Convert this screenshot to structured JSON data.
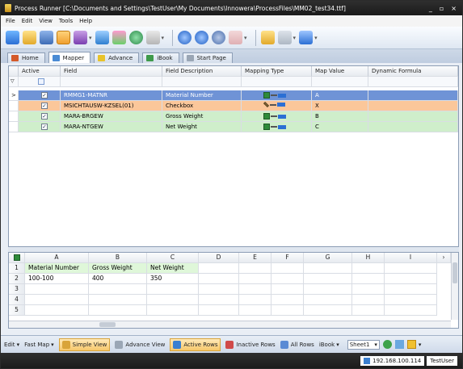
{
  "window": {
    "title": "Process Runner [C:\\Documents and Settings\\TestUser\\My Documents\\Innowera\\ProcessFiles\\MM02_test34.ttf]",
    "minimize": "_",
    "maximize": "▫",
    "close": "×"
  },
  "menu": [
    "File",
    "Edit",
    "View",
    "Tools",
    "Help"
  ],
  "tabs": [
    {
      "label": "Home",
      "icon": "home-icon"
    },
    {
      "label": "Mapper",
      "icon": "mapper-icon"
    },
    {
      "label": "Advance",
      "icon": "advance-icon"
    },
    {
      "label": "iBook",
      "icon": "ibook-icon"
    },
    {
      "label": "Start Page",
      "icon": "start-page-icon"
    }
  ],
  "mapping_grid": {
    "columns": [
      "Active",
      "Field",
      "Field Description",
      "Mapping Type",
      "Map Value",
      "Dynamic Formula"
    ],
    "row_indicator": ">",
    "rows": [
      {
        "active": "✓",
        "field": "RMMG1-MATNR",
        "description": "Material Number",
        "map_value": "A",
        "mapping_type": "excel-column",
        "color": "#6f93d6"
      },
      {
        "active": "✓",
        "field": "MSICHTAUSW-KZSEL(01)",
        "description": "Checkbox",
        "map_value": "X",
        "mapping_type": "fixed-value",
        "color": "#fbc79a"
      },
      {
        "active": "✓",
        "field": "MARA-BRGEW",
        "description": "Gross Weight",
        "map_value": "B",
        "mapping_type": "excel-column",
        "color": "#cfeecb"
      },
      {
        "active": "✓",
        "field": "MARA-NTGEW",
        "description": "Net Weight",
        "map_value": "C",
        "mapping_type": "excel-column",
        "color": "#cfeecb"
      }
    ]
  },
  "sheet_grid": {
    "columns": [
      "A",
      "B",
      "C",
      "D",
      "E",
      "F",
      "G",
      "H",
      "I"
    ],
    "row_numbers": [
      "1",
      "2",
      "3",
      "4",
      "5"
    ],
    "cells": [
      [
        "Material Number",
        "Gross Weight",
        "Net Weight",
        "",
        "",
        "",
        "",
        "",
        ""
      ],
      [
        "100-100",
        "400",
        "350",
        "",
        "",
        "",
        "",
        "",
        ""
      ],
      [
        "",
        "",
        "",
        "",
        "",
        "",
        "",
        "",
        ""
      ],
      [
        "",
        "",
        "",
        "",
        "",
        "",
        "",
        "",
        ""
      ],
      [
        "",
        "",
        "",
        "",
        "",
        "",
        "",
        "",
        ""
      ]
    ]
  },
  "statusbar": {
    "edit": "Edit",
    "fast_map": "Fast Map",
    "simple_view": "Simple View",
    "advance_view": "Advance View",
    "active_rows": "Active Rows",
    "inactive_rows": "Inactive Rows",
    "all_rows": "All Rows",
    "ibook": "iBook",
    "sheet": "Sheet1"
  },
  "connection": {
    "ip": "192.168.100.114",
    "user": "TestUser"
  }
}
